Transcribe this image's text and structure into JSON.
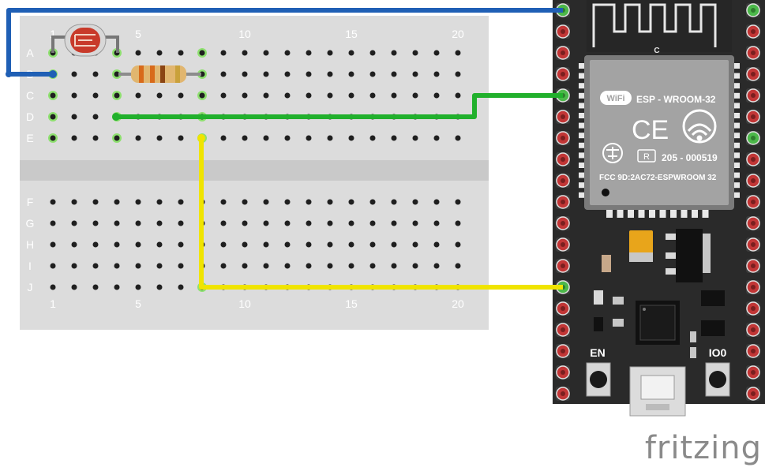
{
  "breadboard": {
    "col_numbers": [
      "1",
      "5",
      "10",
      "15",
      "20"
    ],
    "top_rows": [
      "A",
      "B",
      "C",
      "D",
      "E"
    ],
    "bottom_rows": [
      "F",
      "G",
      "H",
      "I",
      "J"
    ]
  },
  "module": {
    "antenna_label": "C",
    "wifi_badge": "WiFi",
    "model": "ESP - WROOM-32",
    "ce_mark": "CE",
    "cert_r": "R",
    "cert_code": "205 - 000519",
    "fcc": "FCC 9D:2AC72-ESPWROOM 32"
  },
  "buttons": {
    "en": "EN",
    "io0": "IO0"
  },
  "wires": [
    {
      "name": "blue",
      "color": "#1f5fb5"
    },
    {
      "name": "green",
      "color": "#21b02c"
    },
    {
      "name": "yellow",
      "color": "#f0e400"
    }
  ],
  "logo": "fritzing"
}
